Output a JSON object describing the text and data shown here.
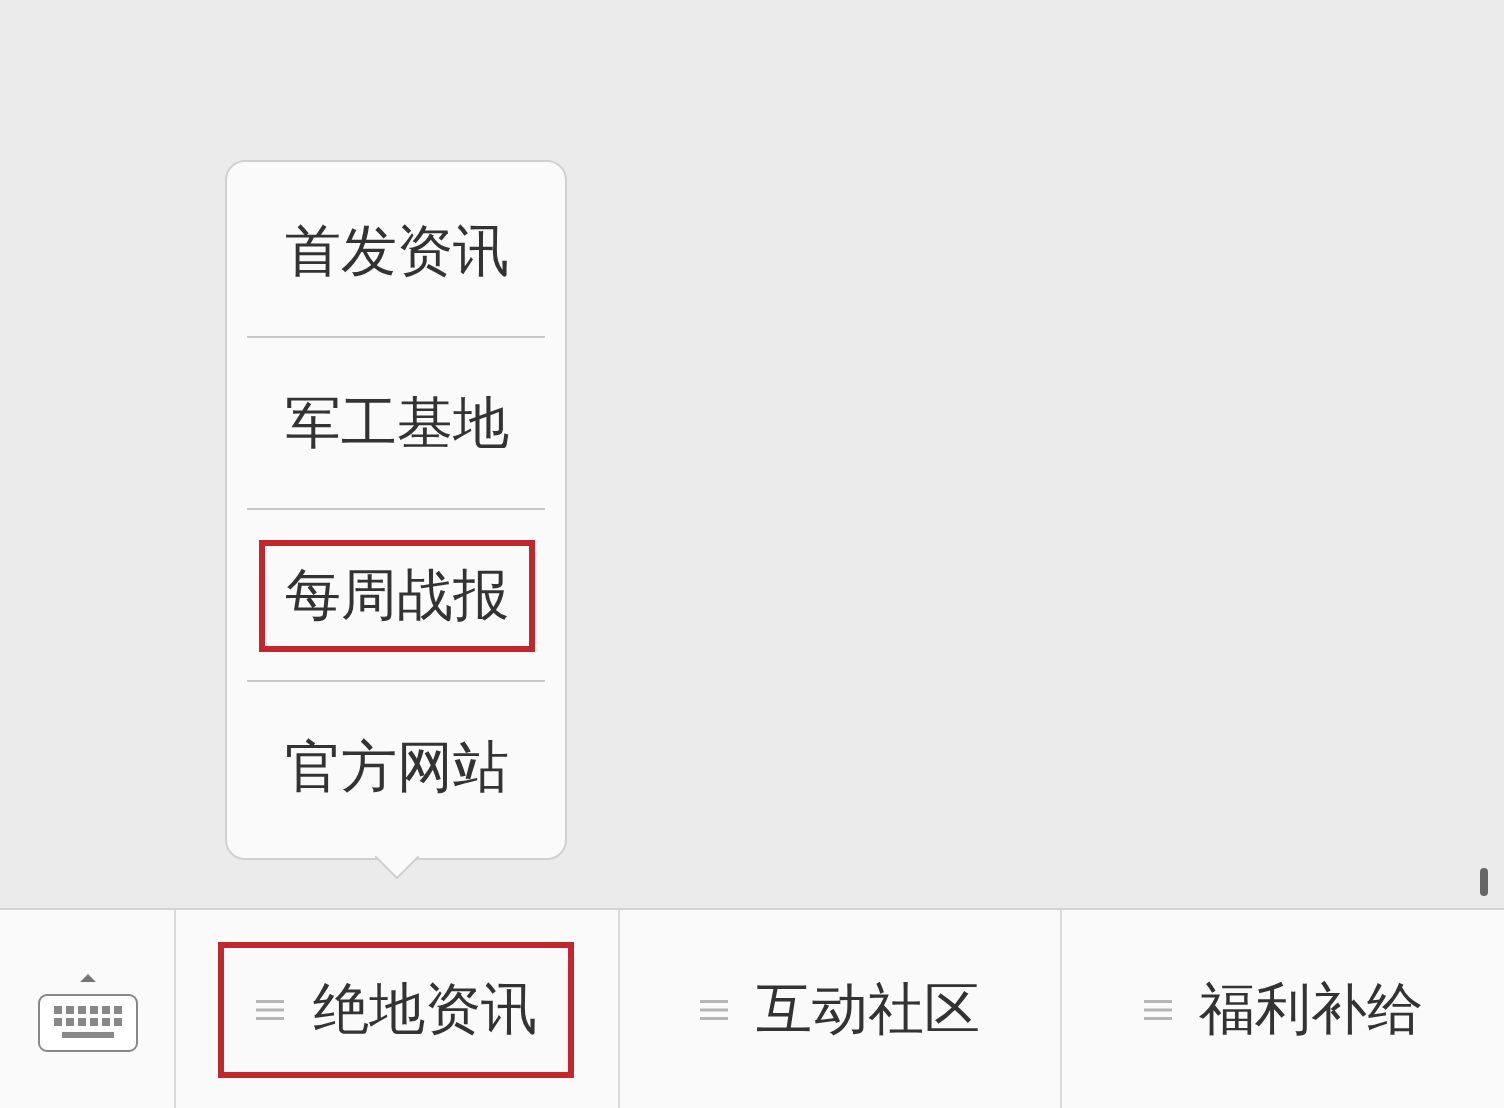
{
  "menu_tabs": [
    {
      "label": "绝地资讯",
      "highlighted": true,
      "submenu": [
        {
          "label": "首发资讯",
          "highlighted": false
        },
        {
          "label": "军工基地",
          "highlighted": false
        },
        {
          "label": "每周战报",
          "highlighted": true
        },
        {
          "label": "官方网站",
          "highlighted": false
        }
      ]
    },
    {
      "label": "互动社区",
      "highlighted": false
    },
    {
      "label": "福利补给",
      "highlighted": false
    }
  ]
}
